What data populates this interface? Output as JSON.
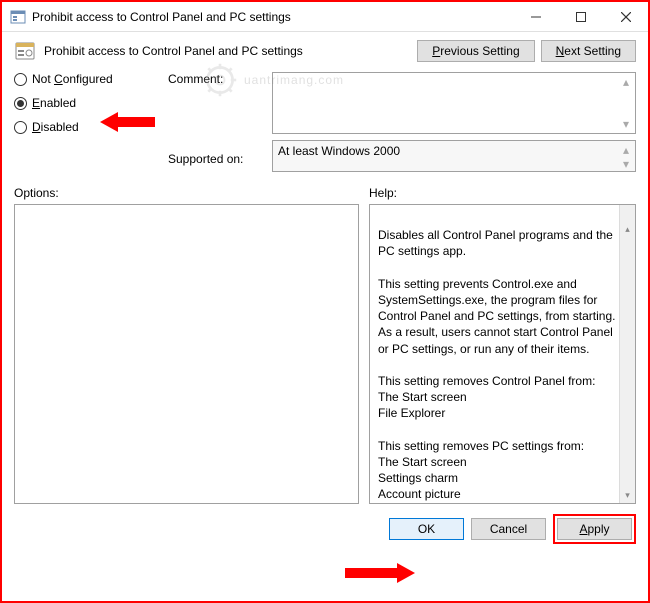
{
  "window": {
    "title": "Prohibit access to Control Panel and PC settings"
  },
  "header": {
    "title": "Prohibit access to Control Panel and PC settings",
    "prev": "Previous Setting",
    "next": "Next Setting"
  },
  "radios": {
    "not_configured": "Not Configured",
    "enabled": "Enabled",
    "disabled": "Disabled",
    "selected": "enabled"
  },
  "labels": {
    "comment": "Comment:",
    "supported": "Supported on:",
    "options": "Options:",
    "help": "Help:"
  },
  "fields": {
    "comment": "",
    "supported": "At least Windows 2000"
  },
  "help_text": "Disables all Control Panel programs and the PC settings app.\n\nThis setting prevents Control.exe and SystemSettings.exe, the program files for Control Panel and PC settings, from starting. As a result, users cannot start Control Panel or PC settings, or run any of their items.\n\nThis setting removes Control Panel from:\nThe Start screen\nFile Explorer\n\nThis setting removes PC settings from:\nThe Start screen\nSettings charm\nAccount picture\nSearch results\n\nIf users try to select a Control Panel item from the Properties item on a context menu, a message appears explaining that a setting prevents the action.",
  "footer": {
    "ok": "OK",
    "cancel": "Cancel",
    "apply": "Apply"
  },
  "watermark": "uantrimang.com"
}
